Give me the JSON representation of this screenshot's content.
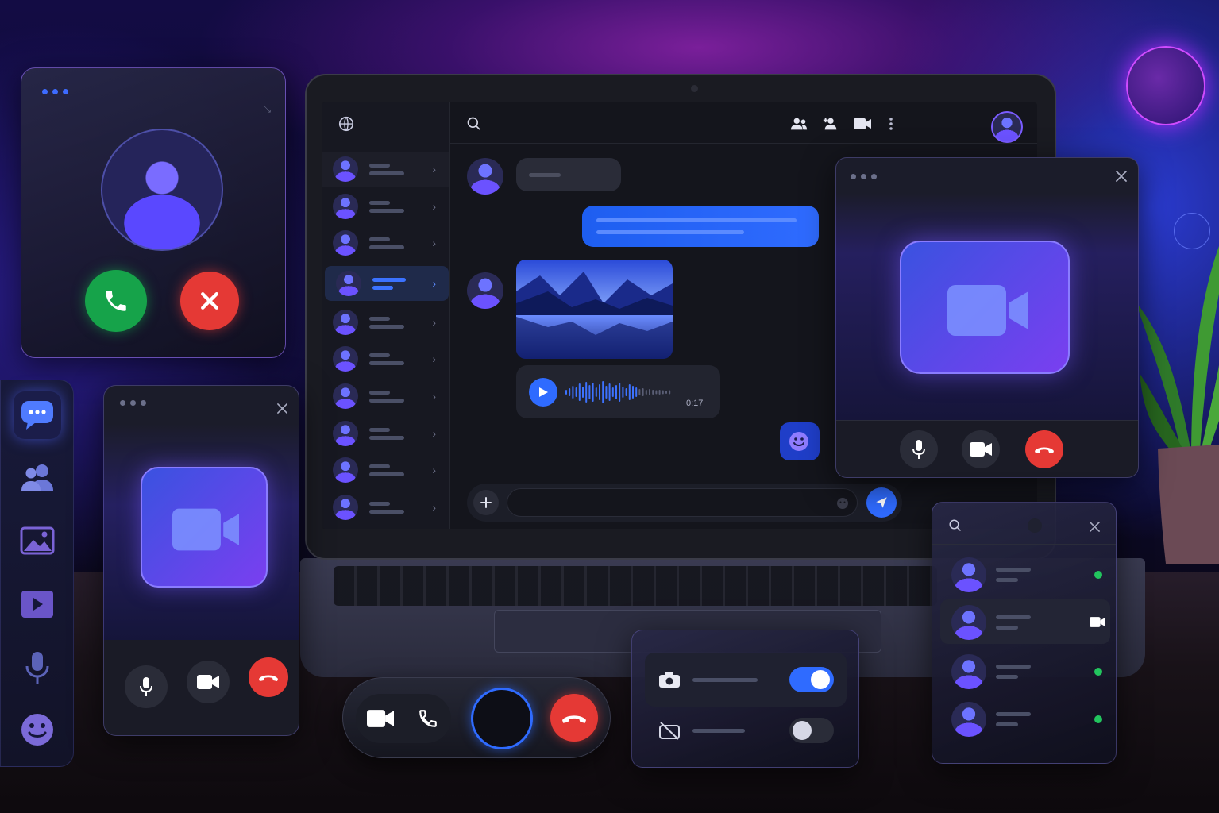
{
  "colors": {
    "accent": "#2f6bff",
    "accept": "#16a34a",
    "decline": "#e53935",
    "online": "#22c55e",
    "violet": "#7b5cff"
  },
  "voice_message": {
    "duration": "0:17"
  },
  "icons": {
    "incoming_call": [
      "avatar-icon",
      "phone-accept-icon",
      "decline-x-icon"
    ],
    "sidebar": [
      "chat-bubble-icon",
      "users-icon",
      "image-icon",
      "play-icon",
      "microphone-icon",
      "emoji-icon"
    ],
    "messenger_header": [
      "globe-icon",
      "search-icon",
      "contacts-icon",
      "add-user-icon",
      "video-camera-icon",
      "more-icon",
      "user-avatar"
    ],
    "composer": [
      "plus-icon",
      "emoji-icon",
      "send-icon"
    ],
    "video_call": [
      "microphone-icon",
      "video-camera-icon",
      "hang-up-icon",
      "close-icon"
    ],
    "call_bar": [
      "video-camera-icon",
      "phone-icon",
      "record-button",
      "hang-up-icon"
    ],
    "settings": [
      "camera-icon",
      "camera-off-icon",
      "toggle-on",
      "toggle-off"
    ],
    "contacts": [
      "search-icon",
      "close-icon",
      "online-dot",
      "video-camera-icon"
    ]
  },
  "settings_toggles": {
    "camera_on": true,
    "camera_off_enabled": false
  },
  "contacts": [
    {
      "status": "online"
    },
    {
      "status": "video"
    },
    {
      "status": "online"
    },
    {
      "status": "online"
    }
  ],
  "chat_list_count": 10,
  "selected_chat_index": 3
}
